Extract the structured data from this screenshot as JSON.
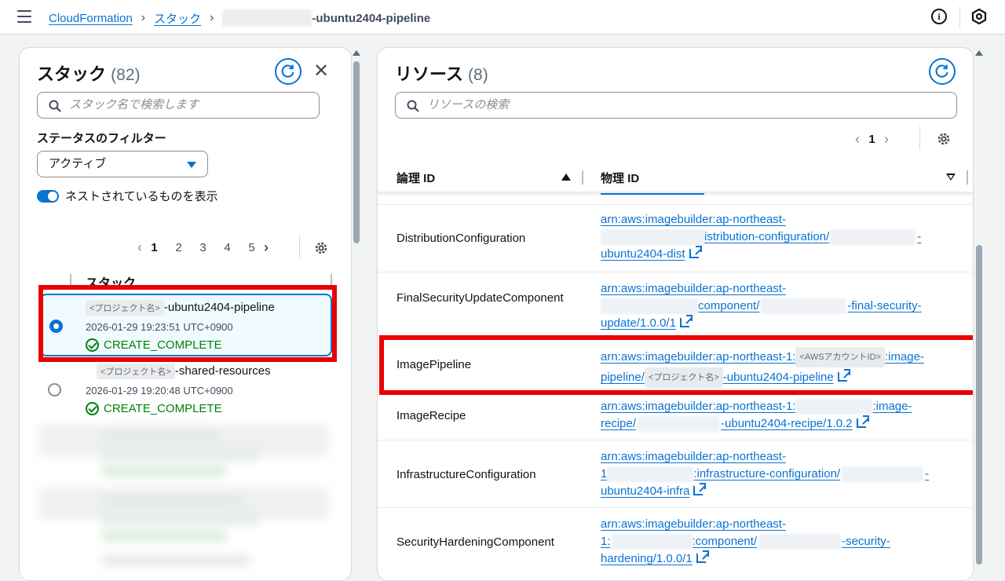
{
  "header": {
    "breadcrumb_root": "CloudFormation",
    "breadcrumb_stacks": "スタック",
    "breadcrumb_current": "-ubuntu2404-pipeline"
  },
  "stacks_panel": {
    "title": "スタック",
    "count": "(82)",
    "search_placeholder": "スタック名で検索します",
    "filter_label": "ステータスのフィルター",
    "filter_value": "アクティブ",
    "toggle_label": "ネストされているものを表示",
    "pages": [
      "1",
      "2",
      "3",
      "4",
      "5"
    ],
    "column_header": "スタック",
    "rows": [
      {
        "mask": "<プロジェクト名>",
        "name_suffix": "-ubuntu2404-pipeline",
        "time": "2026-01-29 19:23:51 UTC+0900",
        "status": "CREATE_COMPLETE",
        "selected": true
      },
      {
        "mask": "<プロジェクト名>",
        "name_suffix": "-shared-resources",
        "time": "2026-01-29 19:20:48 UTC+0900",
        "status": "CREATE_COMPLETE",
        "selected": false
      }
    ]
  },
  "resources_panel": {
    "title": "リソース",
    "count": "(8)",
    "search_placeholder": "リソースの検索",
    "page": "1",
    "col_logical": "論理 ID",
    "col_physical": "物理 ID",
    "rows": [
      {
        "logical": "DistributionConfiguration",
        "line1": "arn:aws:imagebuilder:ap-northeast-",
        "line2_text": "istribution-configuration/",
        "line2_tail": "-",
        "line3": "ubuntu2404-dist"
      },
      {
        "logical": "FinalSecurityUpdateComponent",
        "line1": "arn:aws:imagebuilder:ap-northeast-",
        "line2_text": "component/",
        "line2_tail": "-final-security-",
        "line3": "update/1.0.0/1"
      },
      {
        "logical": "ImagePipeline",
        "line1": "arn:aws:imagebuilder:ap-northeast-1:",
        "line1_mask": "<AWSアカウントID>",
        "line1_tail": ":image-",
        "line2_text": "pipeline/",
        "line2_mask": "<プロジェクト名>",
        "line2_tail": "-ubuntu2404-pipeline"
      },
      {
        "logical": "ImageRecipe",
        "line1": "arn:aws:imagebuilder:ap-northeast-1:",
        "line1_tail": ":image-",
        "line2_text": "recipe/",
        "line2_tail": "-ubuntu2404-recipe/1.0.2"
      },
      {
        "logical": "InfrastructureConfiguration",
        "line1": "arn:aws:imagebuilder:ap-northeast-",
        "line2_text": "1",
        "line2_mid": ":infrastructure-configuration/",
        "line2_tail": "-",
        "line3": "ubuntu2404-infra"
      },
      {
        "logical": "SecurityHardeningComponent",
        "line1": "arn:aws:imagebuilder:ap-northeast-",
        "line2_text": "1:",
        "line2_mid": ":component/",
        "line2_tail": "-security-",
        "line3": "hardening/1.0.0/1"
      }
    ]
  },
  "colors": {
    "accent": "#0972d3",
    "success": "#037f0c",
    "highlight": "#ea0000"
  }
}
